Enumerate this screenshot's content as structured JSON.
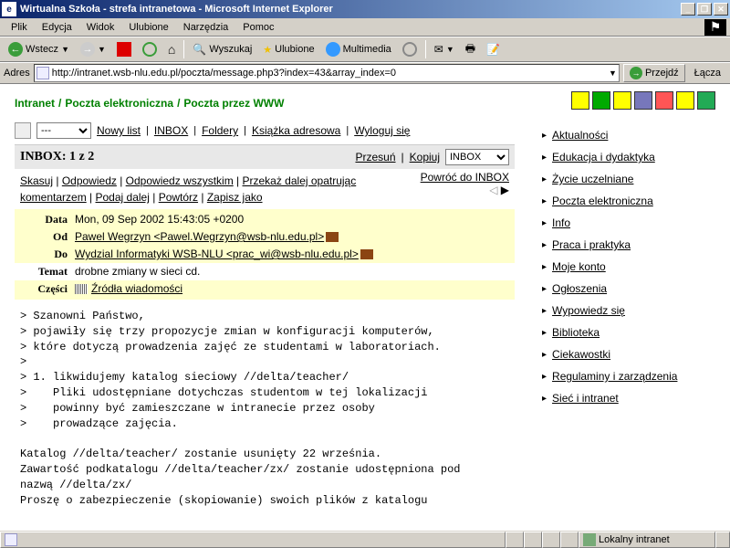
{
  "window": {
    "title": "Wirtualna Szkoła - strefa intranetowa - Microsoft Internet Explorer"
  },
  "menu": {
    "items": [
      "Plik",
      "Edycja",
      "Widok",
      "Ulubione",
      "Narzędzia",
      "Pomoc"
    ]
  },
  "toolbar": {
    "back": "Wstecz",
    "search": "Wyszukaj",
    "favorites": "Ulubione",
    "media": "Multimedia"
  },
  "address": {
    "label": "Adres",
    "url": "http://intranet.wsb-nlu.edu.pl/poczta/message.php3?index=43&array_index=0",
    "go": "Przejdź",
    "links": "Łącza"
  },
  "breadcrumb": {
    "a": "Intranet",
    "b": "Poczta elektroniczna",
    "c": "Poczta przez WWW"
  },
  "nav": {
    "dashes": "---",
    "new": "Nowy list",
    "inbox": "INBOX",
    "folders": "Foldery",
    "addr": "Książka adresowa",
    "logout": "Wyloguj się"
  },
  "inbox": {
    "title": "INBOX: 1 z 2",
    "move": "Przesuń",
    "copy": "Kopiuj",
    "target": "INBOX"
  },
  "actions": {
    "cancel": "Skasuj",
    "reply": "Odpowiedz",
    "replyall": "Odpowiedz wszystkim",
    "fwd": "Przekaż dalej opatrując komentarzem",
    "give": "Podaj dalej",
    "repeat": "Powtórz",
    "save": "Zapisz jako"
  },
  "ret": {
    "label": "Powróć do INBOX"
  },
  "meta": {
    "date_lbl": "Data",
    "date": "Mon, 09 Sep 2002 15:43:05 +0200",
    "from_lbl": "Od",
    "from": "Pawel Wegrzyn <Pawel.Wegrzyn@wsb-nlu.edu.pl>",
    "to_lbl": "Do",
    "to": "Wydzial Informatyki WSB-NLU <prac_wi@wsb-nlu.edu.pl>",
    "subj_lbl": "Temat",
    "subj": "drobne zmiany w sieci cd.",
    "parts_lbl": "Części",
    "src": "Źródła wiadomości"
  },
  "body": "> Szanowni Państwo,\n> pojawiły się trzy propozycje zmian w konfiguracji komputerów,\n> które dotyczą prowadzenia zajęć ze studentami w laboratoriach.\n>\n> 1. likwidujemy katalog sieciowy //delta/teacher/\n>    Pliki udostępniane dotychczas studentom w tej lokalizacji\n>    powinny być zamieszczane w intranecie przez osoby\n>    prowadzące zajęcia.\n\nKatalog //delta/teacher/ zostanie usunięty 22 września.\nZawartość podkatalogu //delta/teacher/zx/ zostanie udostępniona pod\nnazwą //delta/zx/\nProszę o zabezpieczenie (skopiowanie) swoich plików z katalogu",
  "sidebar": {
    "items": [
      "Aktualności",
      "Edukacja i dydaktyka",
      "Życie uczelniane",
      "Poczta elektroniczna",
      "Info",
      "Praca i praktyka",
      "Moje konto",
      "Ogłoszenia",
      "Wypowiedz się",
      "Biblioteka",
      "Ciekawostki",
      "Regulaminy i zarządzenia",
      "Sieć i intranet"
    ]
  },
  "status": {
    "zone": "Lokalny intranet"
  }
}
